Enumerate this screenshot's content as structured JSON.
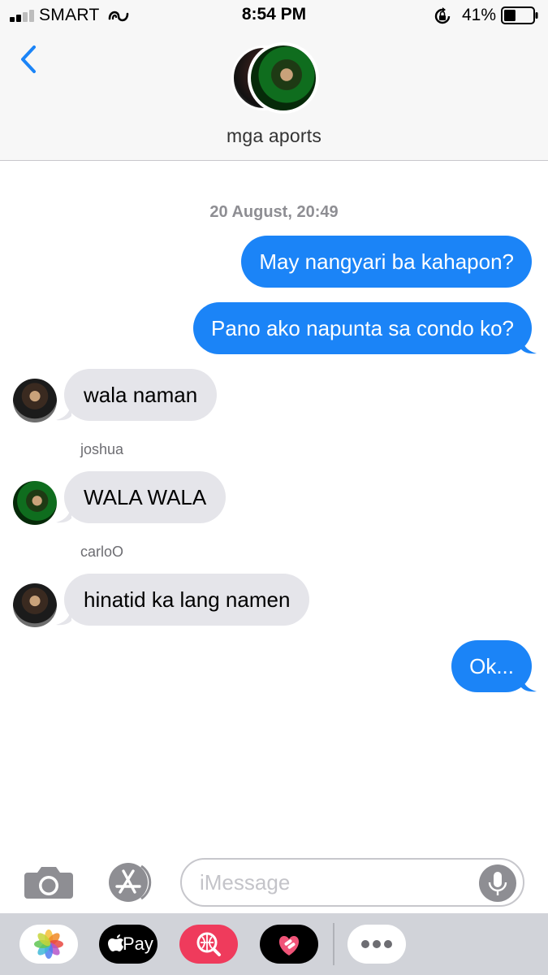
{
  "status_bar": {
    "carrier": "SMART",
    "time": "8:54 PM",
    "battery_percent": "41%",
    "battery_level": 0.41,
    "signal_bars_filled": 2
  },
  "header": {
    "group_name": "mga aports",
    "back_icon": "chevron-left-icon"
  },
  "conversation": {
    "timestamp": "20 August, 20:49",
    "messages": [
      {
        "direction": "sent",
        "text": "May nangyari ba kahapon?"
      },
      {
        "direction": "sent",
        "text": "Pano ako napunta sa condo ko?"
      },
      {
        "direction": "received",
        "text": "wala naman"
      },
      {
        "direction": "received",
        "sender": "joshua",
        "text": "WALA WALA"
      },
      {
        "direction": "received",
        "sender": "carloO",
        "text": "hinatid ka lang namen"
      },
      {
        "direction": "sent",
        "text": "Ok..."
      }
    ]
  },
  "input_bar": {
    "placeholder": "iMessage",
    "value": ""
  },
  "app_drawer": {
    "apps": [
      {
        "icon": "photos-icon"
      },
      {
        "label": "Pay",
        "icon": "apple-pay-icon"
      },
      {
        "icon": "web-images-search-icon"
      },
      {
        "icon": "digital-touch-heart-icon"
      },
      {
        "icon": "more-apps-icon"
      }
    ]
  },
  "colors": {
    "sent_bubble": "#1b84f7",
    "received_bubble": "#e5e5ea",
    "accent_blue": "#1b84f7",
    "header_bg": "#f7f7f7",
    "drawer_bg": "#d1d3d9"
  }
}
